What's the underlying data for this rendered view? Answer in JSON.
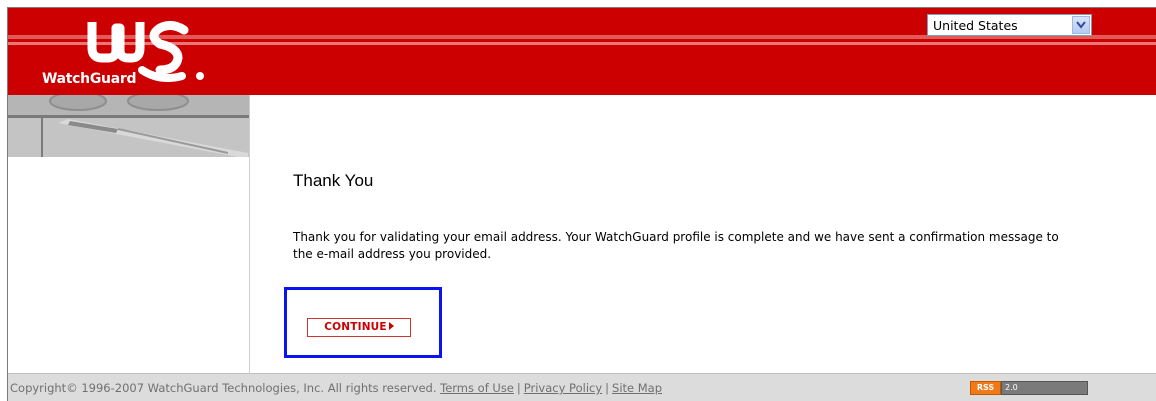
{
  "header": {
    "logo_text": "WatchGuard",
    "country_select": {
      "value": "United States"
    }
  },
  "main": {
    "title": "Thank You",
    "message": "Thank you for validating your email address. Your WatchGuard profile is complete and we have sent a confirmation message to the e-mail address you provided.",
    "continue_label": "CONTINUE"
  },
  "footer": {
    "copyright": "Copyright© 1996-2007 WatchGuard Technologies, Inc. All rights reserved.",
    "links": [
      "Terms of Use",
      "Privacy Policy",
      "Site Map"
    ],
    "separator": "|",
    "rss_label": "RSS",
    "rss_version": "2.0"
  },
  "colors": {
    "header_red": "#cc0000",
    "highlight_blue": "#0a14ee",
    "footer_gray": "#dcdcdc"
  }
}
